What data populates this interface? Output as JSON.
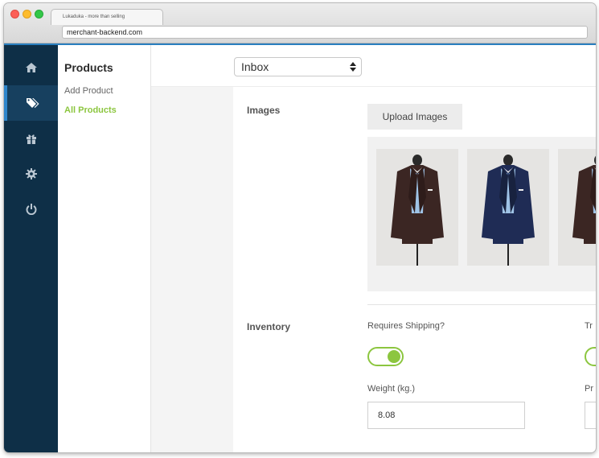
{
  "browser": {
    "tab_title": "Lukaduka - more than selling",
    "url": "merchant-backend.com"
  },
  "rail": {
    "items": [
      {
        "icon": "home-icon"
      },
      {
        "icon": "tags-icon",
        "active": true
      },
      {
        "icon": "gift-icon"
      },
      {
        "icon": "gear-icon"
      },
      {
        "icon": "power-icon"
      }
    ]
  },
  "subnav": {
    "title": "Products",
    "items": [
      {
        "label": "Add Product",
        "active": false
      },
      {
        "label": "All Products",
        "active": true
      }
    ]
  },
  "topbar": {
    "select_value": "Inbox"
  },
  "images_section": {
    "label": "Images",
    "upload_button": "Upload Images",
    "thumbnails": [
      {
        "suit_color": "#3b2623"
      },
      {
        "suit_color": "#1f2c55"
      },
      {
        "suit_color": "#3b2623"
      }
    ]
  },
  "inventory_section": {
    "label": "Inventory",
    "requires_shipping_label": "Requires Shipping?",
    "requires_shipping_on": true,
    "second_toggle_label": "Tr",
    "weight_label": "Weight (kg.)",
    "weight_value": "8.08",
    "second_field_label": "Pr"
  },
  "colors": {
    "sidebar_bg": "#0e2f47",
    "accent_green": "#8cc63f",
    "accent_blue": "#2f86cc"
  }
}
